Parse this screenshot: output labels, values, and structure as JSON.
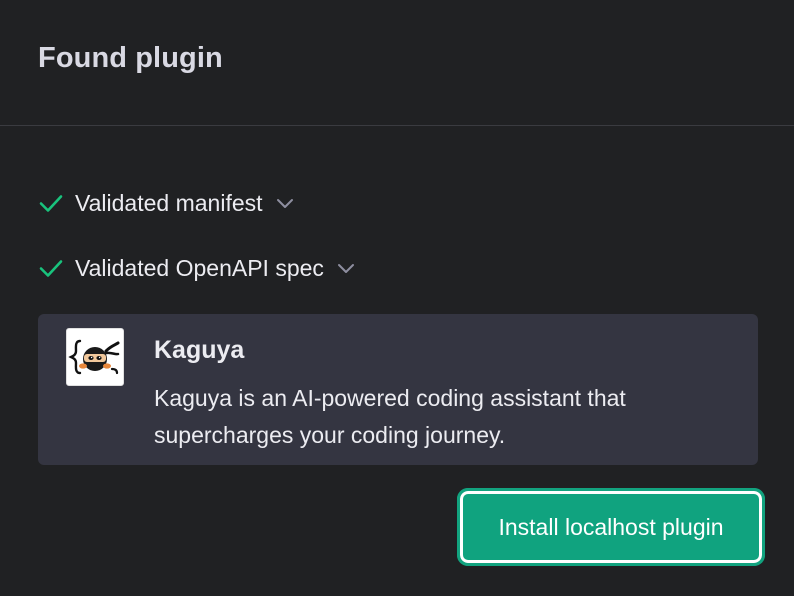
{
  "header": {
    "title": "Found plugin"
  },
  "checks": [
    {
      "label": "Validated manifest",
      "icon": "check-icon",
      "status_color": "#19c37d"
    },
    {
      "label": "Validated OpenAPI spec",
      "icon": "check-icon",
      "status_color": "#19c37d"
    }
  ],
  "plugin": {
    "name": "Kaguya",
    "description": "Kaguya is an AI-powered coding assistant that supercharges your coding journey.",
    "logo_icon": "kaguya-ninja-logo-icon"
  },
  "actions": {
    "install_label": "Install localhost plugin",
    "accent_color": "#10a37f"
  }
}
